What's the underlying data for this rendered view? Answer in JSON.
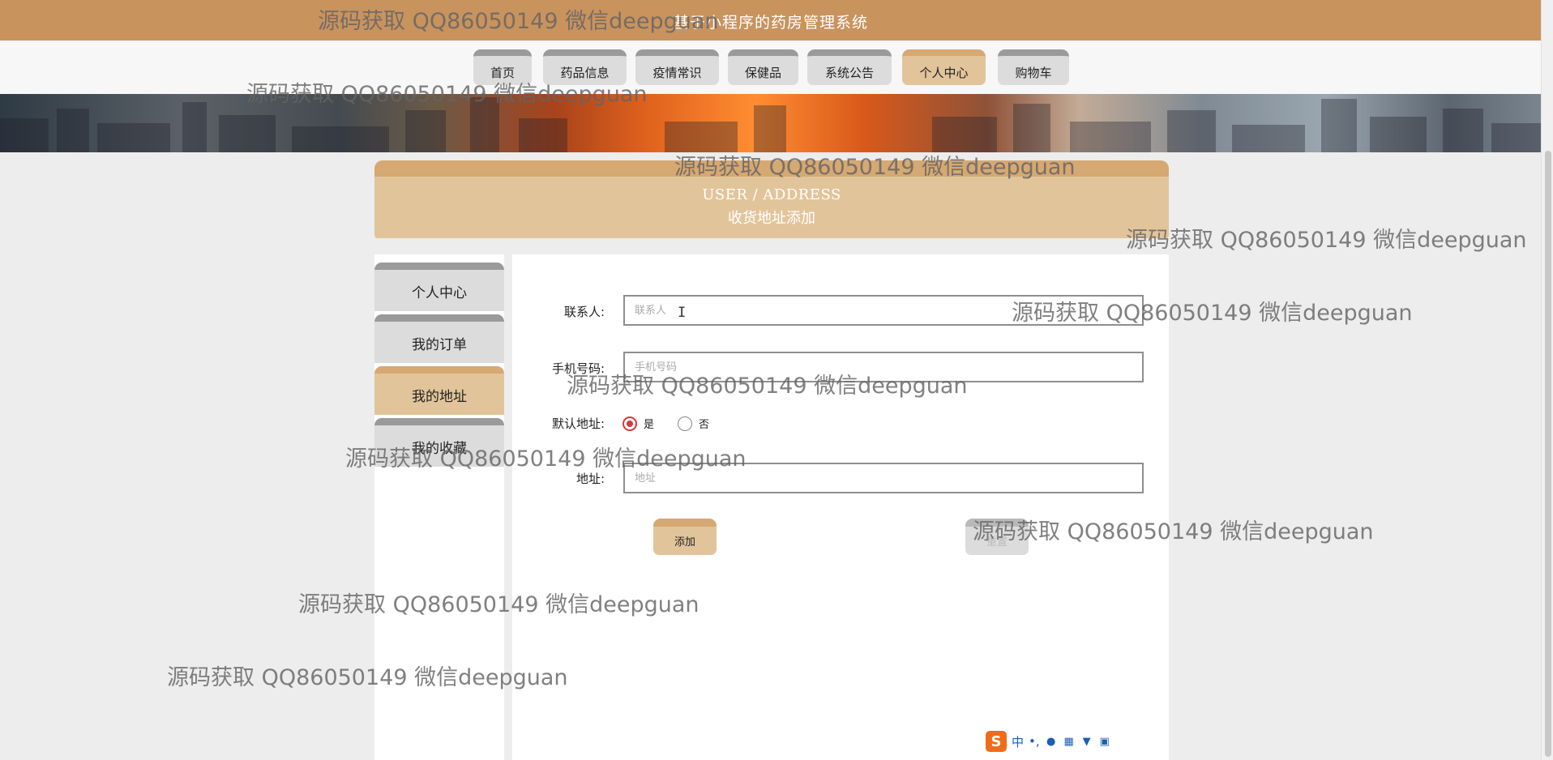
{
  "header": {
    "title": "基于小程序的药房管理系统"
  },
  "nav": {
    "items": [
      {
        "label": "首页",
        "active": false
      },
      {
        "label": "药品信息",
        "active": false
      },
      {
        "label": "疫情常识",
        "active": false
      },
      {
        "label": "保健品",
        "active": false
      },
      {
        "label": "系统公告",
        "active": false
      },
      {
        "label": "个人中心",
        "active": true
      },
      {
        "label": "购物车",
        "active": false
      }
    ]
  },
  "section": {
    "title_en": "USER / ADDRESS",
    "title_cn": "收货地址添加"
  },
  "sidebar": {
    "items": [
      {
        "label": "个人中心",
        "active": false
      },
      {
        "label": "我的订单",
        "active": false
      },
      {
        "label": "我的地址",
        "active": true
      },
      {
        "label": "我的收藏",
        "active": false
      }
    ]
  },
  "form": {
    "contact": {
      "label": "联系人:",
      "placeholder": "联系人",
      "value": ""
    },
    "phone": {
      "label": "手机号码:",
      "placeholder": "手机号码",
      "value": ""
    },
    "default_addr": {
      "label": "默认地址:",
      "options": [
        {
          "label": "是",
          "checked": true
        },
        {
          "label": "否",
          "checked": false
        }
      ]
    },
    "address": {
      "label": "地址:",
      "placeholder": "地址",
      "value": ""
    },
    "add_label": "添加",
    "reset_label": "重置"
  },
  "watermark": {
    "text": "源码获取 QQ86050149 微信deepguan"
  },
  "ime": {
    "lang": "中",
    "punct": "•,"
  },
  "colors": {
    "topbar": "#c9935e",
    "accent": "#e2c49a",
    "accent_dark": "#d6a872",
    "radio": "#d43a3a"
  }
}
